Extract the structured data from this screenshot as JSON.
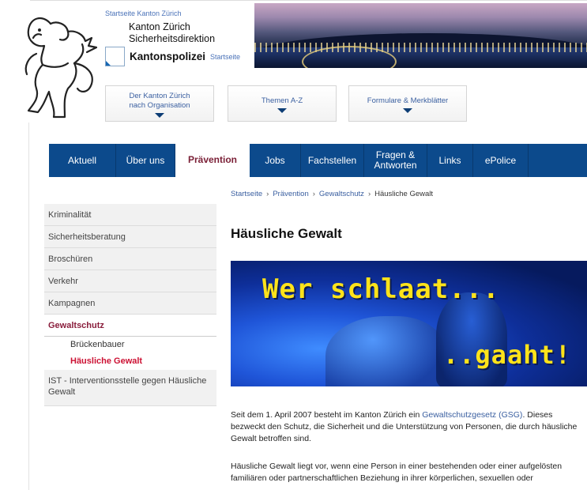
{
  "header": {
    "kanton_link": "Startseite Kanton Zürich",
    "kanton_line1": "Kanton Zürich",
    "kanton_line2": "Sicherheitsdirektion",
    "kapo_name": "Kantonspolizei",
    "kapo_start": "Startseite"
  },
  "dropdowns": [
    {
      "label": "Der Kanton Zürich nach Organisation"
    },
    {
      "label": "Themen A-Z"
    },
    {
      "label": "Formulare & Merkblätter"
    }
  ],
  "nav": {
    "items": [
      {
        "label": "Aktuell"
      },
      {
        "label": "Über uns"
      },
      {
        "label": "Prävention"
      },
      {
        "label": "Jobs"
      },
      {
        "label": "Fachstellen"
      },
      {
        "label": "Fragen & Antworten"
      },
      {
        "label": "Links"
      },
      {
        "label": "ePolice"
      }
    ],
    "active": "Prävention"
  },
  "breadcrumb": {
    "items": [
      "Startseite",
      "Prävention",
      "Gewaltschutz"
    ],
    "current": "Häusliche Gewalt",
    "separator": "›"
  },
  "sidebar": {
    "items": [
      {
        "label": "Kriminalität"
      },
      {
        "label": "Sicherheitsberatung"
      },
      {
        "label": "Broschüren"
      },
      {
        "label": "Verkehr"
      },
      {
        "label": "Kampagnen"
      },
      {
        "label": "Gewaltschutz"
      }
    ],
    "sub_items": [
      {
        "label": "Brückenbauer"
      },
      {
        "label": "Häusliche Gewalt"
      }
    ],
    "last_item": "IST - Interventionsstelle gegen Häusliche Gewalt"
  },
  "main": {
    "title": "Häusliche Gewalt",
    "hero_line1": "Wer schlaat...",
    "hero_line2": "..gaaht!",
    "p1_before": "Seit dem 1. April 2007 besteht im Kanton Zürich ein ",
    "p1_link": "Gewaltschutzgesetz (GSG)",
    "p1_after": ". Dieses bezweckt den Schutz, die Sicherheit und die Unterstützung von Personen, die durch häusliche Gewalt betroffen sind.",
    "p2": "Häusliche Gewalt liegt vor, wenn eine Person in einer bestehenden oder einer aufgelösten familiären oder partnerschaftlichen Beziehung in ihrer körperlichen, sexuellen oder"
  },
  "colors": {
    "nav_bg": "#0c4a8c",
    "active_text": "#7a1f36",
    "sub_active": "#cc1133",
    "link": "#3a5fa0",
    "hero_text": "#ffe31a"
  }
}
